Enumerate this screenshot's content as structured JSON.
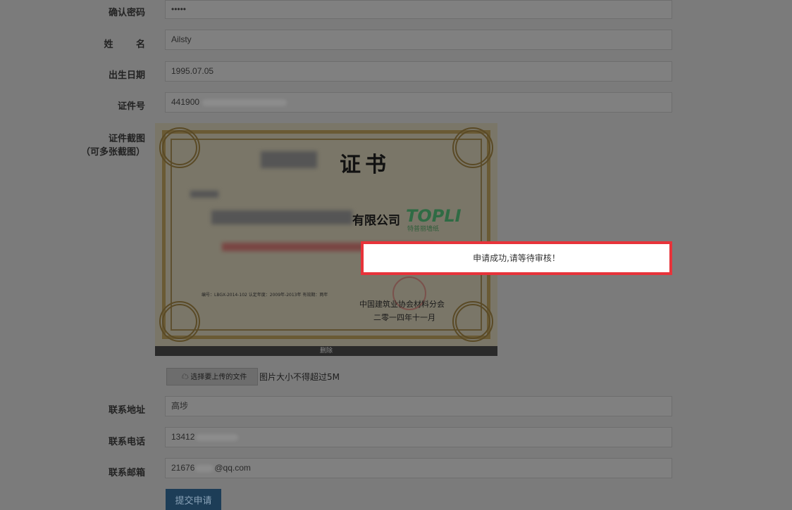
{
  "form": {
    "confirm_password": {
      "label": "确认密码",
      "value": "•••••"
    },
    "name": {
      "label": "姓 名",
      "value": "Ailsty"
    },
    "birthdate": {
      "label": "出生日期",
      "value": "1995.07.05"
    },
    "id_number": {
      "label": "证件号",
      "value_prefix": "441900",
      "value_suffix": ""
    },
    "id_screenshot": {
      "label": "证件截图",
      "sublabel": "（可多张截图）"
    },
    "address": {
      "label": "联系地址",
      "value": "高埗"
    },
    "phone": {
      "label": "联系电话",
      "value_prefix": "13412"
    },
    "email": {
      "label": "联系邮箱",
      "value_prefix": "21676",
      "value_suffix": "@qq.com"
    }
  },
  "certificate": {
    "title": "证书",
    "company": "有限公司",
    "logo": "TOPLI",
    "logo_sub": "特普丽墙纸",
    "fine_print": "编号：LBGX-2014-102    认定年度：2009年-2013年    有效期：两年",
    "issuer": "中国建筑业协会材料分会",
    "date": "二零一四年十一月"
  },
  "upload": {
    "delete_label": "删除",
    "button_label": "选择要上传的文件",
    "hint": "图片大小不得超过5M"
  },
  "submit_label": "提交申请",
  "modal": {
    "message": "申请成功,请等待审核！"
  },
  "colors": {
    "overlay": "#7b7b7b",
    "modal_border": "#e7333a",
    "submit_bg": "#1d3d57"
  }
}
